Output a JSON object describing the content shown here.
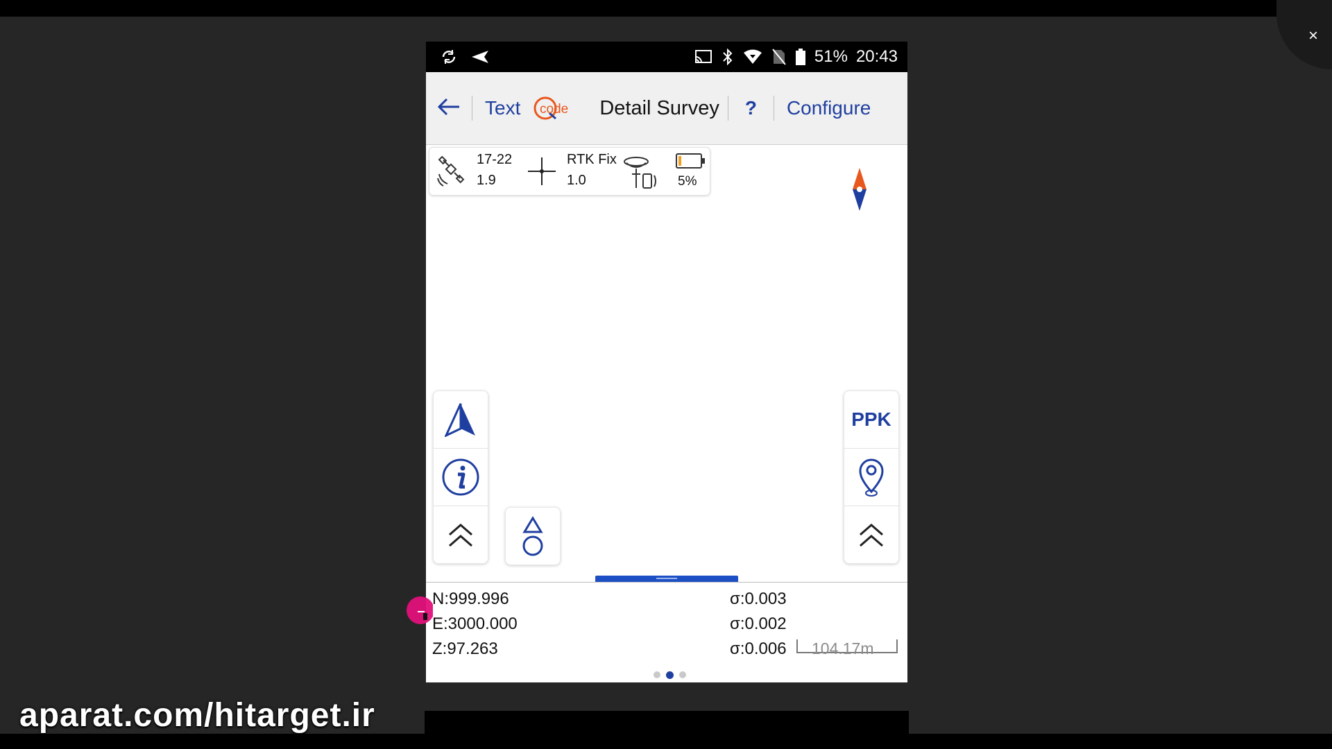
{
  "status_bar": {
    "battery_percent": "51%",
    "time": "20:43",
    "icons": [
      "sync-icon",
      "send-icon",
      "cast-icon",
      "bluetooth-icon",
      "wifi-icon",
      "no-sim-icon",
      "battery-icon"
    ]
  },
  "app_bar": {
    "text_label": "Text",
    "code_label": "code",
    "title": "Detail Survey",
    "help_label": "?",
    "configure_label": "Configure"
  },
  "gnss": {
    "satellites": "17-22",
    "pdop": "1.9",
    "solution": "RTK Fix",
    "age": "1.0",
    "receiver_battery": "5%"
  },
  "right_tools": {
    "ppk_label": "PPK"
  },
  "coordinates": {
    "n": "N:999.996",
    "e": "E:3000.000",
    "z": "Z:97.263",
    "sigma_n": "σ:0.003",
    "sigma_e": "σ:0.002",
    "sigma_z": "σ:0.006"
  },
  "scale": {
    "label": "104.17m"
  },
  "pager": {
    "page_count": 3,
    "active_index": 1
  },
  "watermark": {
    "text": "aparat.com/hitarget.ir"
  },
  "window": {
    "close_label": "×"
  },
  "colors": {
    "accent": "#1f3fa0",
    "compass_north": "#e8571e",
    "handle": "#1d4fc4",
    "touch": "#e0107a"
  }
}
